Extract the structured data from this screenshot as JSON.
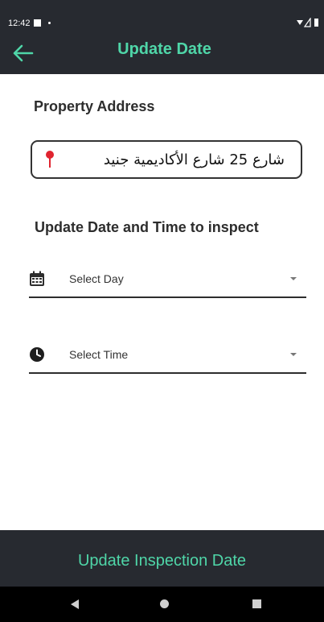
{
  "status_bar": {
    "time": "12:42"
  },
  "app_bar": {
    "title": "Update Date"
  },
  "property": {
    "heading": "Property Address",
    "address": "شارع 25 شارع الأكاديمية جنيد"
  },
  "schedule": {
    "heading": "Update Date and Time to inspect",
    "day_placeholder": "Select Day",
    "time_placeholder": "Select Time"
  },
  "action": {
    "label": "Update Inspection Date"
  },
  "colors": {
    "accent": "#4fd6a8",
    "bar_background": "#272a30",
    "pin": "#e0242f"
  },
  "icons": {
    "back": "arrow-left-icon",
    "pin": "location-pin-icon",
    "day": "calendar-icon",
    "time": "clock-icon"
  }
}
